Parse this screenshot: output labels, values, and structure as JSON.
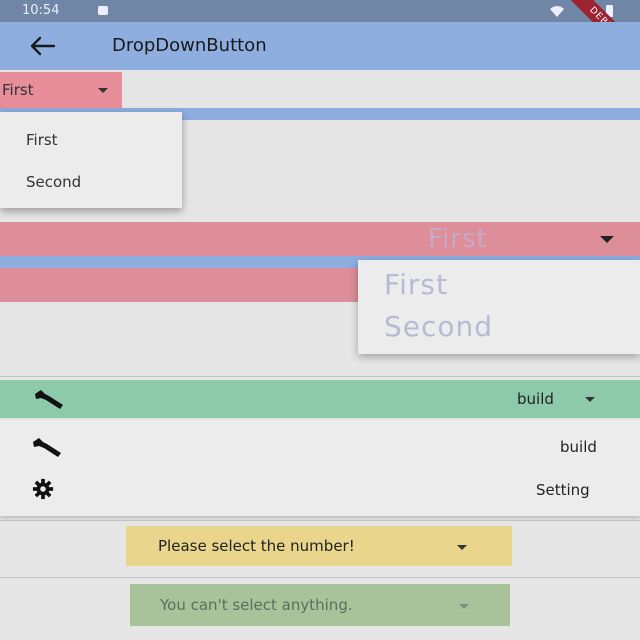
{
  "status_bar": {
    "time": "10:54"
  },
  "debug_banner": "DEBUG",
  "app_bar": {
    "title": "DropDownButton"
  },
  "dropdown1": {
    "selected": "First",
    "menu": [
      "First",
      "Second"
    ]
  },
  "dropdown2": {
    "selected_ghost": "First",
    "menu": [
      "First",
      "Second"
    ]
  },
  "dropdown3": {
    "selected": "build",
    "menu": [
      {
        "label": "build",
        "icon": "wrench-icon"
      },
      {
        "label": "Setting",
        "icon": "gear-icon"
      }
    ]
  },
  "hint_dropdown": {
    "text": "Please select the number!"
  },
  "disabled_dropdown": {
    "text": "You can't select anything."
  },
  "colors": {
    "app_bar": "#8eaee0",
    "pink": "#dd8e99",
    "green": "#8ccaa9",
    "yellow": "#e9d68c",
    "disabled_green": "#a8c39a"
  }
}
